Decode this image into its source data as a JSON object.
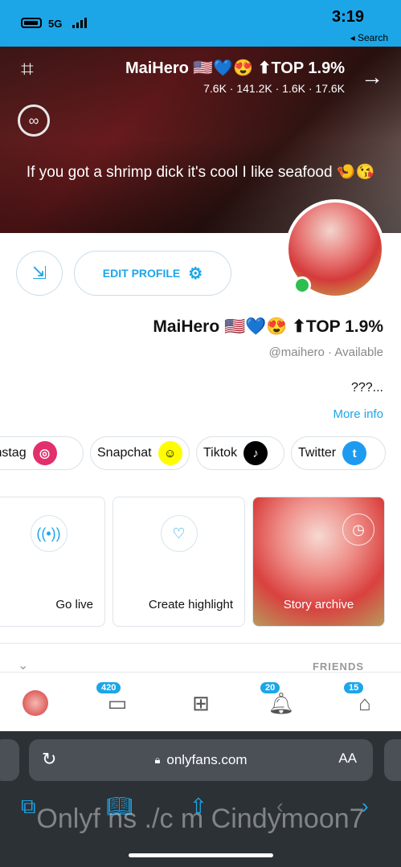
{
  "status_bar": {
    "time": "3:19",
    "back_label": "◂ Search",
    "network": "5G",
    "battery": "battery"
  },
  "cover": {
    "title": "MaiHero 🇺🇸💙😍 ⬆TOP 1.9%",
    "stats": "7.6K · 141.2K · 1.6K · 17.6K",
    "quote": "If you got a shrimp dick it's cool I like seafood 🍤😘"
  },
  "profile": {
    "edit_label": "EDIT PROFILE",
    "name": "MaiHero 🇺🇸💙😍 ⬆TOP 1.9%",
    "handle": "@maihero · Available",
    "bio": "???...",
    "more": "More info"
  },
  "socials": [
    {
      "label": "Twitter",
      "color": "#1d9bf0",
      "icon": "twitter-icon"
    },
    {
      "label": "Tiktok",
      "color": "#000000",
      "icon": "tiktok-icon"
    },
    {
      "label": "Snapchat",
      "color": "#fffc00",
      "icon": "snapchat-icon"
    },
    {
      "label": "Instag",
      "color": "#e1306c",
      "icon": "instagram-icon"
    }
  ],
  "cards": {
    "archive": "Story archive",
    "highlight": "Create highlight",
    "live": "Go live"
  },
  "friends_label": "FRIENDS",
  "nav": {
    "home_badge": "15",
    "notif_badge": "20",
    "msg_badge": "420"
  },
  "browser": {
    "url": "onlyfans.com",
    "aa": "AA",
    "watermark": "Onlyf ns ./c m Cindymoon7"
  },
  "colors": {
    "accent": "#1ca6e8",
    "online": "#2ebe4f"
  }
}
